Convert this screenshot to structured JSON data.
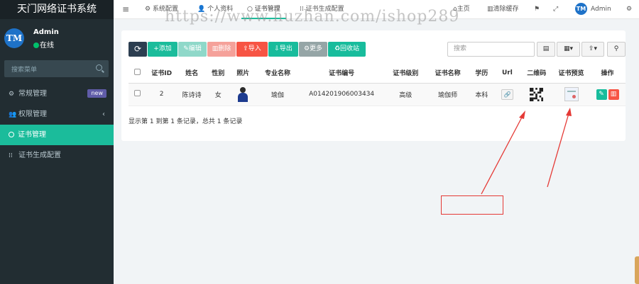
{
  "app": {
    "title": "天门网络证书系统"
  },
  "user": {
    "avatar_text": "TM",
    "name": "Admin",
    "status": "在线"
  },
  "sidebar": {
    "search_placeholder": "搜索菜单",
    "items": [
      {
        "label": "常规管理",
        "badge": "new",
        "icon": "gears-icon"
      },
      {
        "label": "权限管理",
        "icon": "users-icon"
      },
      {
        "label": "证书管理",
        "icon": "circle-icon",
        "active": true
      },
      {
        "label": "证书生成配置",
        "icon": "grid-icon"
      }
    ]
  },
  "topnav": {
    "menu_glyph": "≡",
    "tabs": [
      {
        "label": "系统配置"
      },
      {
        "label": "个人资料"
      },
      {
        "label": "证书管理"
      },
      {
        "label": "证书生成配置"
      }
    ],
    "home": "主页",
    "clear_cache": "清除缓存",
    "user_name": "Admin",
    "watermark": "https://www.huzhan.com/ishop289"
  },
  "toolbar": {
    "refresh": "⟳",
    "add": "添加",
    "edit": "编辑",
    "delete": "删除",
    "import": "导入",
    "export": "导出",
    "more": "更多",
    "recycle": "回收站",
    "search_placeholder": "搜索"
  },
  "table": {
    "headers": [
      "证书ID",
      "姓名",
      "性别",
      "照片",
      "专业名称",
      "证书编号",
      "证书级别",
      "证书名称",
      "学历",
      "Url",
      "二维码",
      "证书预览",
      "操作"
    ],
    "rows": [
      {
        "id": "2",
        "name": "陈诗诗",
        "gender": "女",
        "major": "瑜伽",
        "cert_no": "A014201906003434",
        "level": "高级",
        "cert_name": "瑜伽师",
        "education": "本科"
      }
    ],
    "footer": "显示第 1 到第 1 条记录，总共 1 条记录"
  },
  "colors": {
    "sidebar_bg": "#222d32",
    "accent": "#1bbc9b",
    "danger": "#f75444",
    "primary_dark": "#2c3e50",
    "more": "#95a5a6",
    "annotation_red": "#e53935"
  }
}
